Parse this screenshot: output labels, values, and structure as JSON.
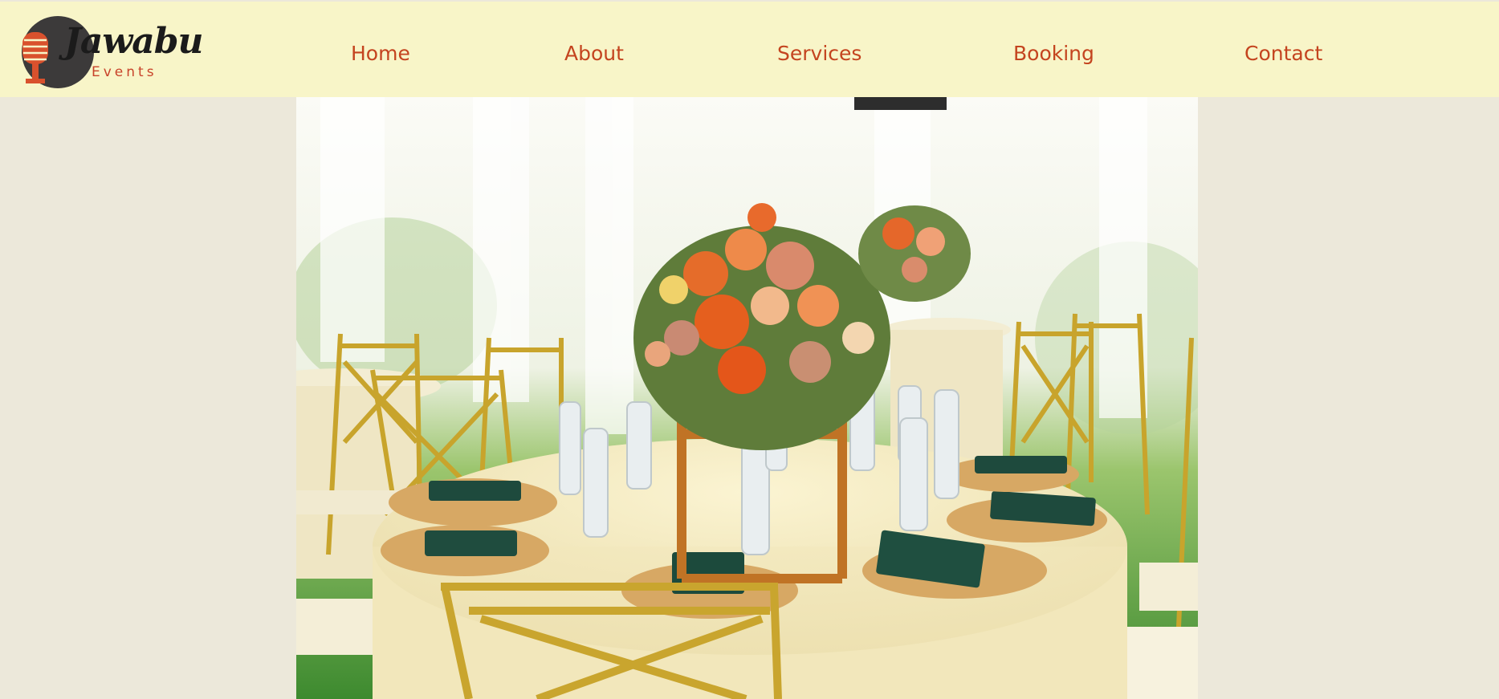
{
  "brand": {
    "name": "Jawabu",
    "tagline": "Events"
  },
  "nav": {
    "items": [
      {
        "label": "Home"
      },
      {
        "label": "About"
      },
      {
        "label": "Services"
      },
      {
        "label": "Booking"
      },
      {
        "label": "Contact"
      }
    ]
  },
  "colors": {
    "header_bg": "#f8f5c8",
    "page_bg": "#ece8da",
    "accent": "#c4441f"
  },
  "hero": {
    "image": "event-table-setting-photo"
  }
}
